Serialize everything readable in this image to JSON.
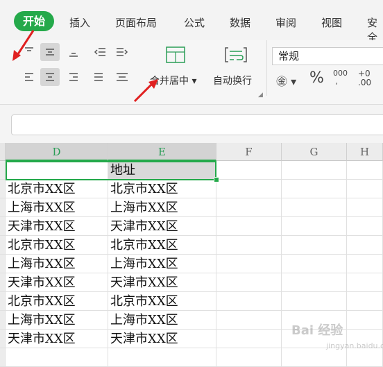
{
  "tabs": {
    "active": "开始",
    "items": [
      "插入",
      "页面布局",
      "公式",
      "数据",
      "审阅",
      "视图",
      "安全"
    ]
  },
  "toolbar": {
    "merge_center_label": "合并居中",
    "wrap_text_label": "自动换行",
    "number_format": "常规",
    "percent_symbol": "%",
    "thousands_symbol": "000",
    "decimal_increase": "+0",
    "decimal_decrease": ".00"
  },
  "columns": [
    "D",
    "E",
    "F",
    "G",
    "H"
  ],
  "selected_columns": [
    "D",
    "E"
  ],
  "header_row": {
    "D": "",
    "E": "地址"
  },
  "rows": [
    [
      "北京市XX区",
      "北京市XX区"
    ],
    [
      "上海市XX区",
      "上海市XX区"
    ],
    [
      "天津市XX区",
      "天津市XX区"
    ],
    [
      "北京市XX区",
      "北京市XX区"
    ],
    [
      "上海市XX区",
      "上海市XX区"
    ],
    [
      "天津市XX区",
      "天津市XX区"
    ],
    [
      "北京市XX区",
      "北京市XX区"
    ],
    [
      "上海市XX区",
      "上海市XX区"
    ],
    [
      "天津市XX区",
      "天津市XX区"
    ]
  ],
  "watermark": {
    "text": "Bai 经验",
    "sub": "jingyan.baidu.com"
  },
  "colors": {
    "accent": "#24a94a",
    "arrow": "#e02020"
  }
}
